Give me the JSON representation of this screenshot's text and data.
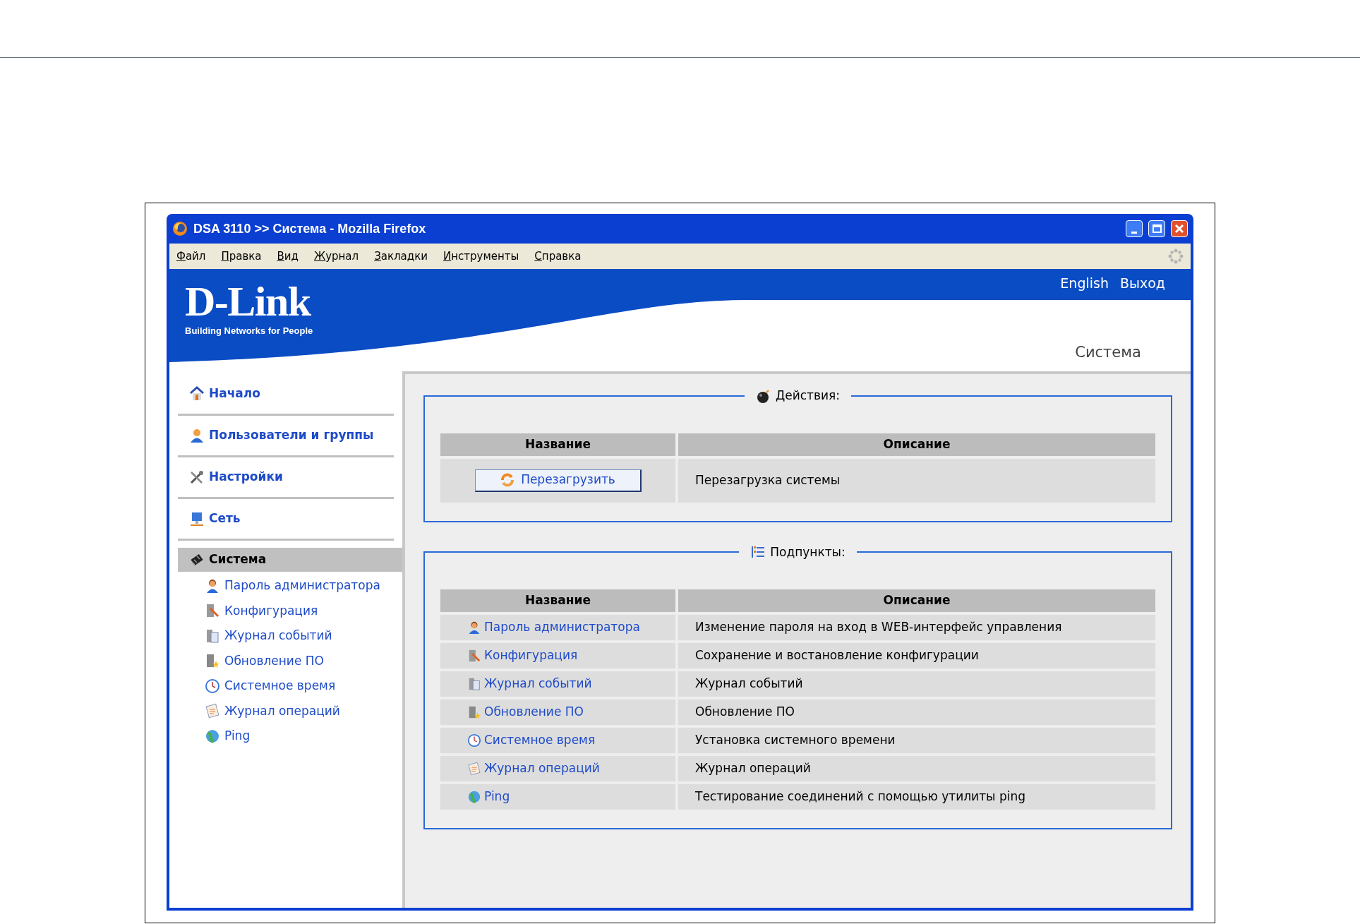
{
  "window": {
    "title": "DSA 3110 >> Система - Mozilla Firefox"
  },
  "menu": [
    "Файл",
    "Правка",
    "Вид",
    "Журнал",
    "Закладки",
    "Инструменты",
    "Справка"
  ],
  "header": {
    "logo": "D-Link",
    "tagline": "Building Networks for People",
    "links": [
      "English",
      "Выход"
    ],
    "page_title": "Система"
  },
  "sidebar": {
    "items": [
      {
        "label": "Начало",
        "selected": false
      },
      {
        "label": "Пользователи и группы",
        "selected": false
      },
      {
        "label": "Настройки",
        "selected": false
      },
      {
        "label": "Сеть",
        "selected": false
      },
      {
        "label": "Система",
        "selected": true,
        "children": [
          {
            "label": "Пароль администратора"
          },
          {
            "label": "Конфигурация"
          },
          {
            "label": "Журнал событий"
          },
          {
            "label": "Обновление ПО"
          },
          {
            "label": "Системное время"
          },
          {
            "label": "Журнал операций"
          },
          {
            "label": "Ping"
          }
        ]
      }
    ]
  },
  "actions": {
    "title": "Действия:",
    "columns": [
      "Название",
      "Описание"
    ],
    "rows": [
      {
        "button": "Перезагрузить",
        "description": "Перезагрузка системы"
      }
    ]
  },
  "subitems": {
    "title": "Подпункты:",
    "columns": [
      "Название",
      "Описание"
    ],
    "rows": [
      {
        "name": "Пароль администратора",
        "description": "Изменение пароля на вход в WEB-интерфейс управления"
      },
      {
        "name": "Конфигурация",
        "description": "Сохранение и востановление конфигурации"
      },
      {
        "name": "Журнал событий",
        "description": "Журнал событий"
      },
      {
        "name": "Обновление ПО",
        "description": "Обновление ПО"
      },
      {
        "name": "Системное время",
        "description": "Установка системного времени"
      },
      {
        "name": "Журнал операций",
        "description": "Журнал операций"
      },
      {
        "name": "Ping",
        "description": "Тестирование соединений с помощью утилиты ping"
      }
    ]
  }
}
